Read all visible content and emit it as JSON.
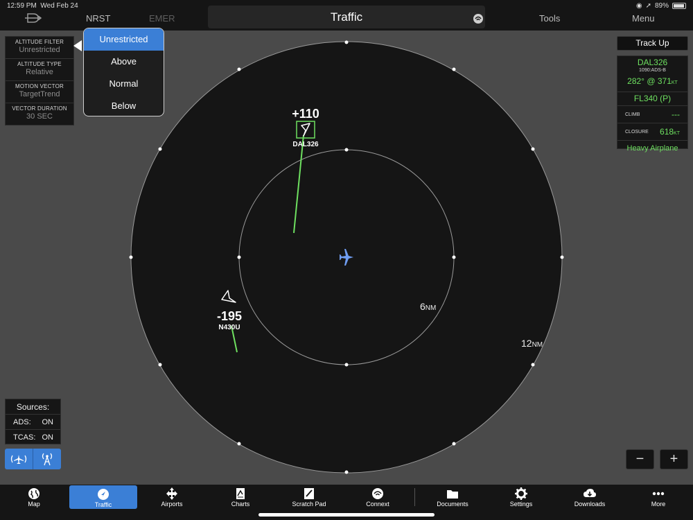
{
  "status_bar": {
    "time": "12:59 PM",
    "date": "Wed Feb 24",
    "battery": "89%"
  },
  "nav": {
    "nrst": "NRST",
    "emer": "EMER",
    "title": "Traffic",
    "tools": "Tools",
    "menu": "Menu"
  },
  "settings": [
    {
      "label": "ALTITUDE FILTER",
      "value": "Unrestricted"
    },
    {
      "label": "ALTITUDE TYPE",
      "value": "Relative"
    },
    {
      "label": "MOTION VECTOR",
      "value": "TargetTrend"
    },
    {
      "label": "VECTOR DURATION",
      "value": "30 SEC"
    }
  ],
  "altitude_filter_menu": {
    "options": [
      "Unrestricted",
      "Above",
      "Normal",
      "Below"
    ],
    "selected": "Unrestricted"
  },
  "sources": {
    "title": "Sources:",
    "ads_label": "ADS:",
    "ads_value": "ON",
    "tcas_label": "TCAS:",
    "tcas_value": "ON"
  },
  "orientation": "Track Up",
  "selected_target": {
    "callsign": "DAL326",
    "source": "1090:ADS-B",
    "track": "282°",
    "at": "@",
    "speed": "371",
    "speed_unit": "KT",
    "flight_level": "FL340 (P)",
    "climb_label": "CLIMB",
    "climb_value": "---",
    "closure_label": "CLOSURE",
    "closure_value": "618",
    "closure_unit": "KT",
    "type": "Heavy Airplane"
  },
  "radar": {
    "inner_ring_label": "6",
    "outer_ring_label": "12",
    "range_unit": "NM",
    "targets": [
      {
        "id": "DAL326",
        "relative_altitude": "+110",
        "selected": true
      },
      {
        "id": "N430U",
        "relative_altitude": "-195",
        "selected": false
      }
    ]
  },
  "zoom": {
    "minus": "−",
    "plus": "+"
  },
  "tabs": [
    "Map",
    "Traffic",
    "Airports",
    "Charts",
    "Scratch Pad",
    "Connext",
    "Documents",
    "Settings",
    "Downloads",
    "More"
  ],
  "active_tab": "Traffic",
  "colors": {
    "accent": "#3b7fd6",
    "target_green": "#6ee060",
    "radar_bg": "#151515",
    "background": "#4a4a4a"
  }
}
